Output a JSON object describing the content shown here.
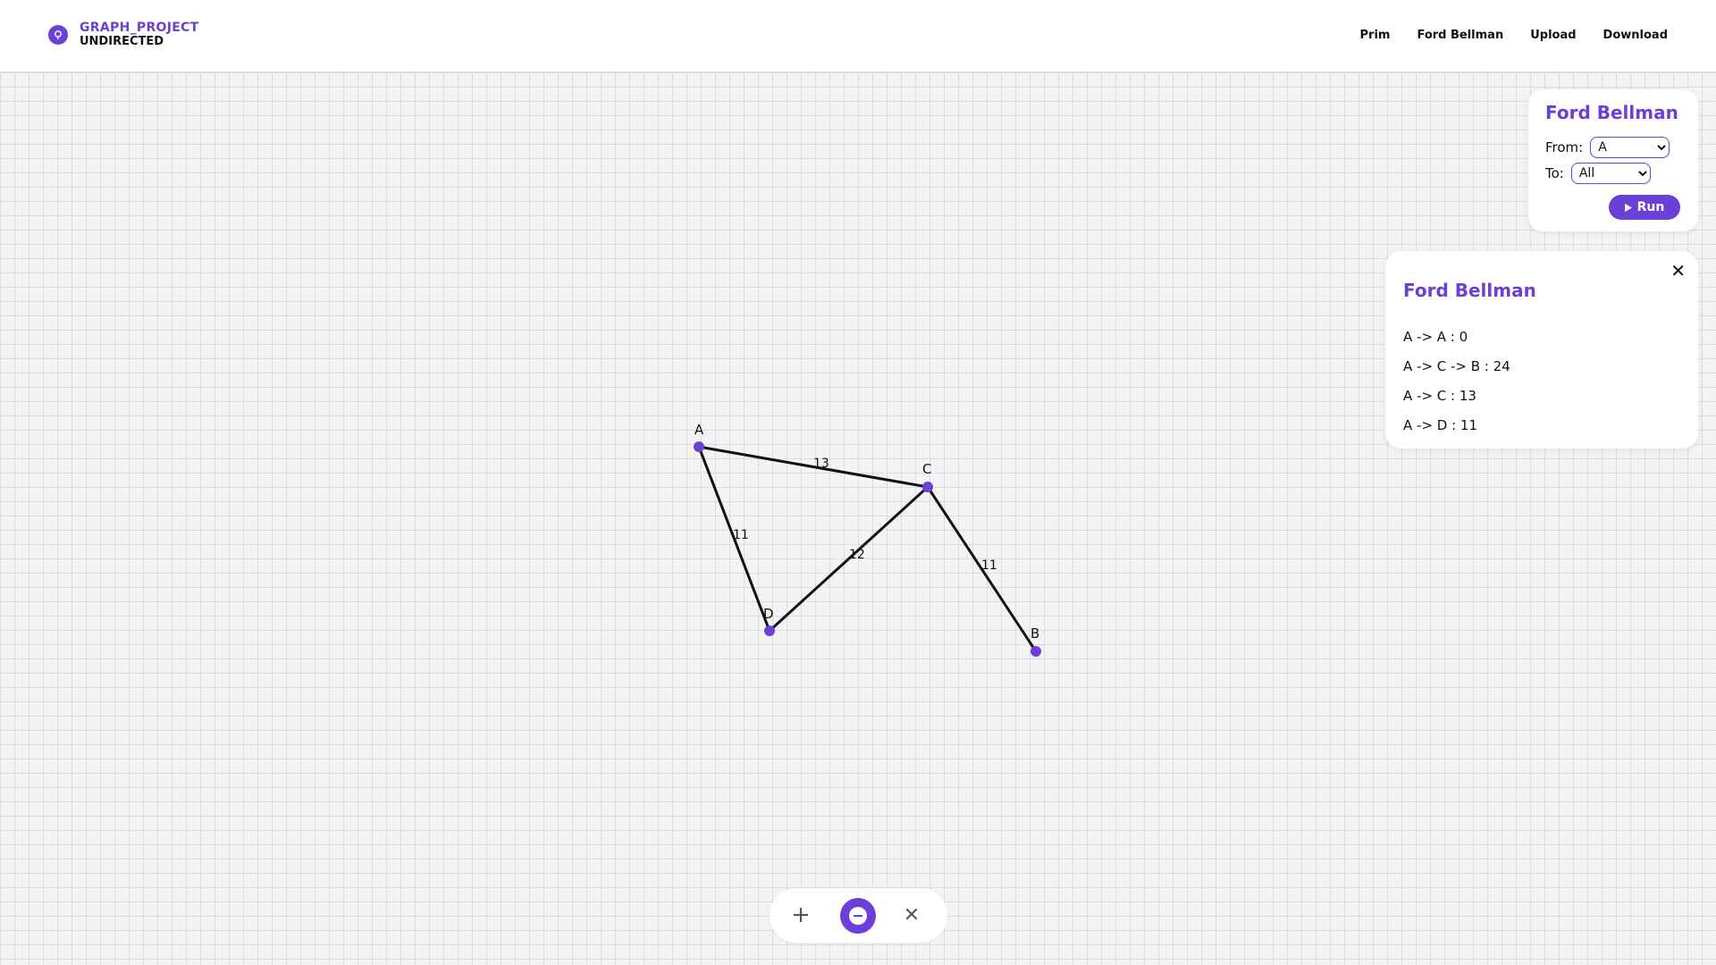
{
  "app": {
    "title": "GRAPH_PROJECT",
    "mode": "UNDIRECTED"
  },
  "nav": {
    "items": [
      "Prim",
      "Ford Bellman",
      "Upload",
      "Download"
    ]
  },
  "algorithm_panel": {
    "title": "Ford Bellman",
    "from_label": "From:",
    "from_value": "A",
    "to_label": "To:",
    "to_value": "All",
    "run_label": "Run"
  },
  "result_panel": {
    "title": "Ford Bellman",
    "close_icon": "close-icon",
    "results": [
      "A -> A : 0",
      "A -> C -> B : 24",
      "A -> C : 13",
      "A -> D : 11"
    ]
  },
  "graph": {
    "accent_color": "#6c3fd6",
    "node_labels": {
      "A": "A",
      "B": "B",
      "C": "C",
      "D": "D"
    },
    "edges": [
      {
        "from": "A",
        "to": "C",
        "weight": "13"
      },
      {
        "from": "A",
        "to": "D",
        "weight": "11"
      },
      {
        "from": "D",
        "to": "C",
        "weight": "12"
      },
      {
        "from": "C",
        "to": "B",
        "weight": "11"
      }
    ]
  },
  "toolbar": {
    "add_icon": "plus-icon",
    "remove_icon": "minus-circle-icon",
    "close_icon": "close-icon"
  },
  "colors": {
    "accent": "#6c3fd6",
    "background": "#f4f4f6",
    "grid": "#dcdce0"
  }
}
